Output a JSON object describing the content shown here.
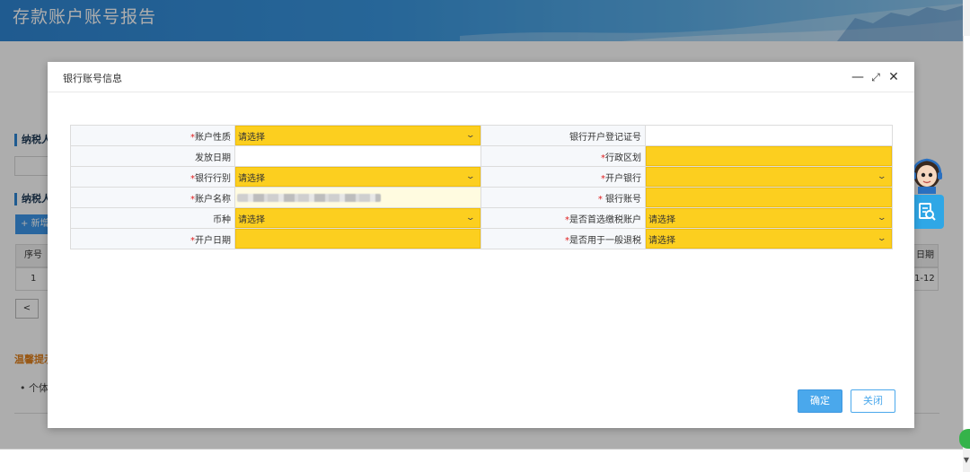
{
  "page": {
    "title": "存款账户账号报告"
  },
  "background": {
    "section1_title": "纳税人",
    "section2_title": "纳税人",
    "add_button": "+ 新增",
    "table_header_index": "序号",
    "table_row_index": "1",
    "table_header_right": "日期",
    "table_row_right": "1-12",
    "pager_prev": "<",
    "tip_title": "温馨提示",
    "tip_text": "• 个体"
  },
  "modal": {
    "title": "银行账号信息",
    "controls": {
      "minimize": "—",
      "maximize": "⤢",
      "close": "✕"
    },
    "rows": [
      {
        "left_label": "账户性质",
        "left_required": true,
        "left_value": "请选择",
        "left_type": "select",
        "right_label": "银行开户登记证号",
        "right_required": false,
        "right_value": "",
        "right_type": "text"
      },
      {
        "left_label": "发放日期",
        "left_required": false,
        "left_value": "",
        "left_type": "text",
        "right_label": "行政区划",
        "right_required": true,
        "right_value": "",
        "right_type": "required-input"
      },
      {
        "left_label": "银行行别",
        "left_required": true,
        "left_value": "请选择",
        "left_type": "select",
        "right_label": "开户银行",
        "right_required": true,
        "right_value": "",
        "right_type": "select"
      },
      {
        "left_label": "账户名称",
        "left_required": true,
        "left_value": "",
        "left_type": "readonly",
        "right_label": " 银行账号",
        "right_required": true,
        "right_value": "",
        "right_type": "required-input"
      },
      {
        "left_label": "币种",
        "left_required": false,
        "left_value": "请选择",
        "left_type": "select",
        "right_label": "是否首选缴税账户",
        "right_required": true,
        "right_value": "请选择",
        "right_type": "select"
      },
      {
        "left_label": "开户日期",
        "left_required": true,
        "left_value": "",
        "left_type": "required-input",
        "right_label": "是否用于一般退税",
        "right_required": true,
        "right_value": "请选择",
        "right_type": "select"
      }
    ],
    "ok_button": "确定",
    "close_button": "关闭"
  },
  "colors": {
    "banner": "#2f86d4",
    "required_field": "#fccf1f",
    "primary_button": "#4aa8ec",
    "required_mark": "#e02020"
  },
  "icons": {
    "assistant_avatar": "assistant-avatar-icon",
    "assistant_search": "search-document-icon",
    "select_arrow": "chevron-down-icon"
  }
}
